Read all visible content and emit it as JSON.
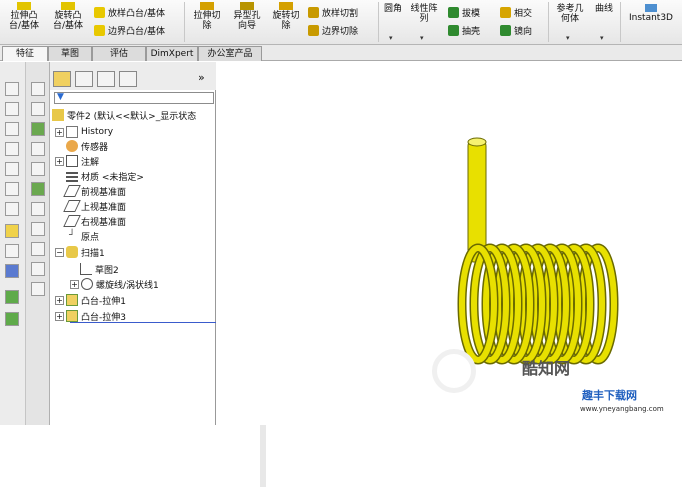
{
  "ribbon": {
    "extrude_boss": "拉伸凸\n台/基体",
    "revolve_boss": "旋转凸\n台/基体",
    "sweep_boss": "放样凸台/基体",
    "boundary_boss": "边界凸台/基体",
    "extrude_cut": "拉伸切\n除",
    "hole_wizard": "异型孔\n向导",
    "revolve_cut": "旋转切\n除",
    "loft_cut": "放样切割",
    "boundary_cut": "边界切除",
    "fillet": "圆角",
    "linear_pattern": "线性阵\n列",
    "draft": "拔模",
    "shell": "抽壳",
    "intersect": "相交",
    "mirror": "镜向",
    "ref_geometry": "参考几\n何体",
    "curves": "曲线",
    "instant3d": "Instant3D"
  },
  "tabs": [
    "特征",
    "草图",
    "评估",
    "DimXpert",
    "办公室产品"
  ],
  "tree": {
    "root": "零件2 (默认<<默认>_显示状态",
    "items": [
      {
        "label": "History",
        "exp": "+"
      },
      {
        "label": "传感器",
        "exp": ""
      },
      {
        "label": "注解",
        "exp": "+"
      },
      {
        "label": "材质 <未指定>",
        "exp": ""
      },
      {
        "label": "前视基准面",
        "exp": ""
      },
      {
        "label": "上视基准面",
        "exp": ""
      },
      {
        "label": "右视基准面",
        "exp": ""
      },
      {
        "label": "原点",
        "exp": ""
      },
      {
        "label": "扫描1",
        "exp": "−"
      },
      {
        "label": "草图2",
        "exp": ""
      },
      {
        "label": "螺旋线/涡状线1",
        "exp": "+"
      },
      {
        "label": "凸台-拉伸1",
        "exp": "+"
      },
      {
        "label": "凸台-拉伸3",
        "exp": "+"
      }
    ]
  },
  "watermark": {
    "brand": "酷知网",
    "site_cn": "趣丰下载网",
    "site_url": "www.yneyangbang.com"
  },
  "colors": {
    "spring": "#e8e000",
    "spring_dark": "#6a6a00",
    "selection_line": "#3a5bcc"
  }
}
